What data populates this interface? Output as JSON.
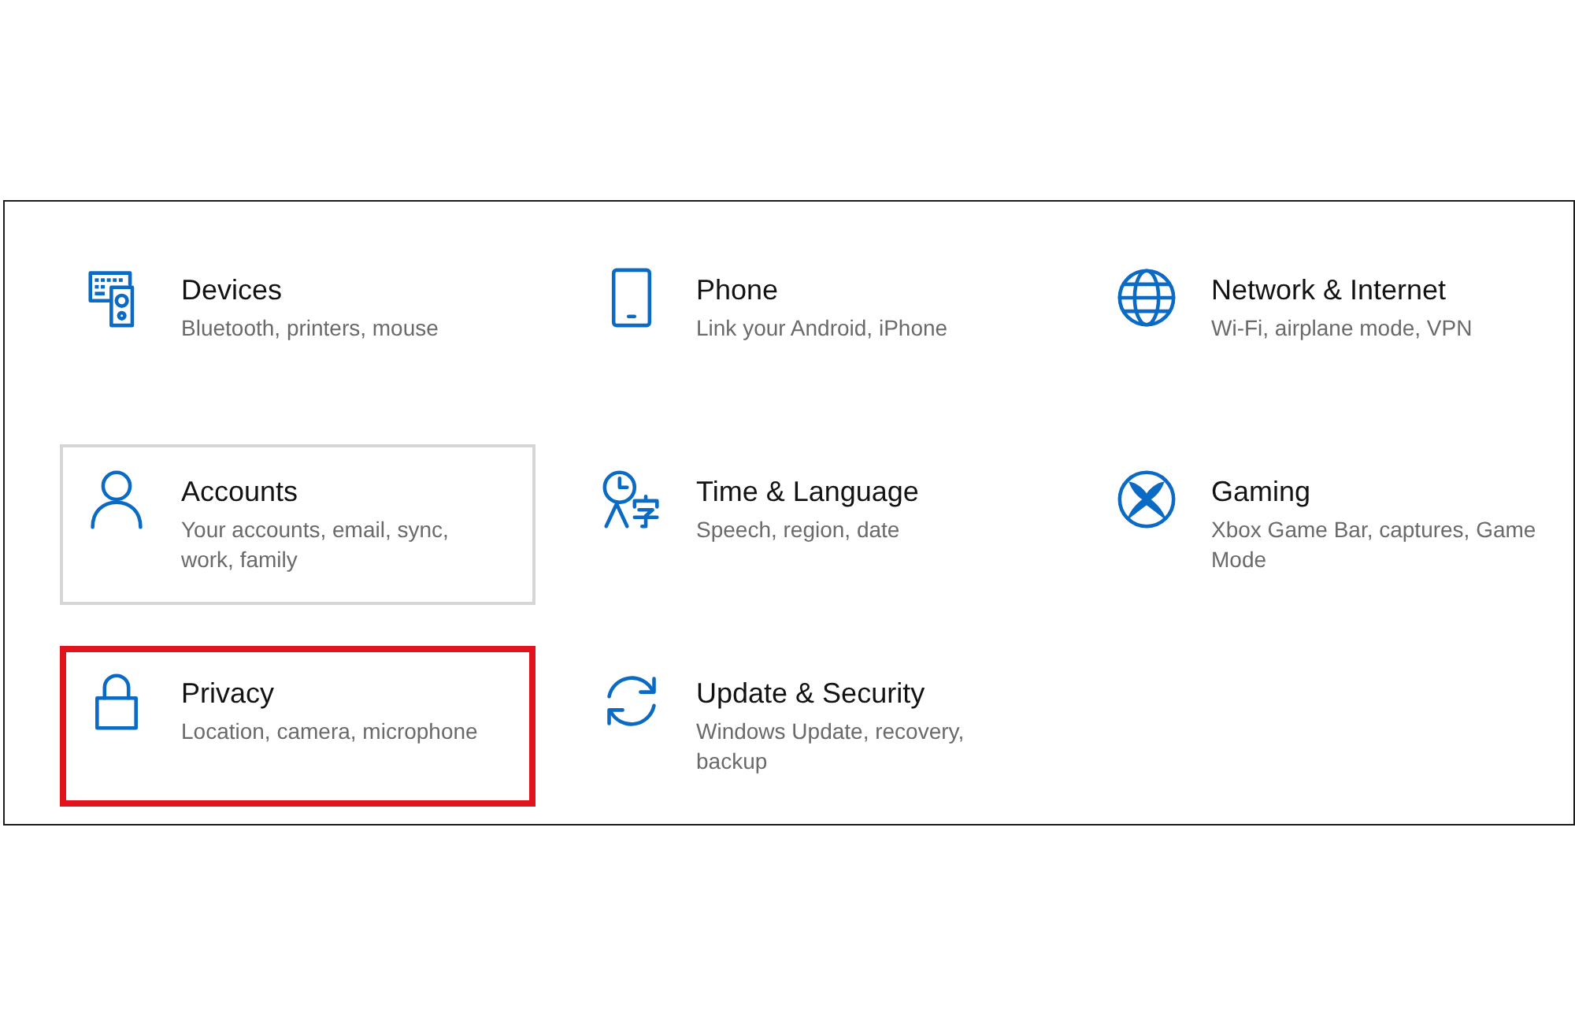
{
  "tiles": [
    {
      "kind": "devices",
      "title": "Devices",
      "description": "Bluetooth, printers, mouse",
      "hovered": false,
      "highlighted": false
    },
    {
      "kind": "phone",
      "title": "Phone",
      "description": "Link your Android, iPhone",
      "hovered": false,
      "highlighted": false
    },
    {
      "kind": "network",
      "title": "Network & Internet",
      "description": "Wi-Fi, airplane mode, VPN",
      "hovered": false,
      "highlighted": false
    },
    {
      "kind": "accounts",
      "title": "Accounts",
      "description": "Your accounts, email, sync,\nwork, family",
      "hovered": true,
      "highlighted": false
    },
    {
      "kind": "time",
      "title": "Time & Language",
      "description": "Speech, region, date",
      "hovered": false,
      "highlighted": false
    },
    {
      "kind": "gaming",
      "title": "Gaming",
      "description": "Xbox Game Bar, captures, Game\nMode",
      "hovered": false,
      "highlighted": false
    },
    {
      "kind": "privacy",
      "title": "Privacy",
      "description": "Location, camera, microphone",
      "hovered": false,
      "highlighted": true
    },
    {
      "kind": "update",
      "title": "Update & Security",
      "description": "Windows Update, recovery,\nbackup",
      "hovered": false,
      "highlighted": false
    }
  ]
}
